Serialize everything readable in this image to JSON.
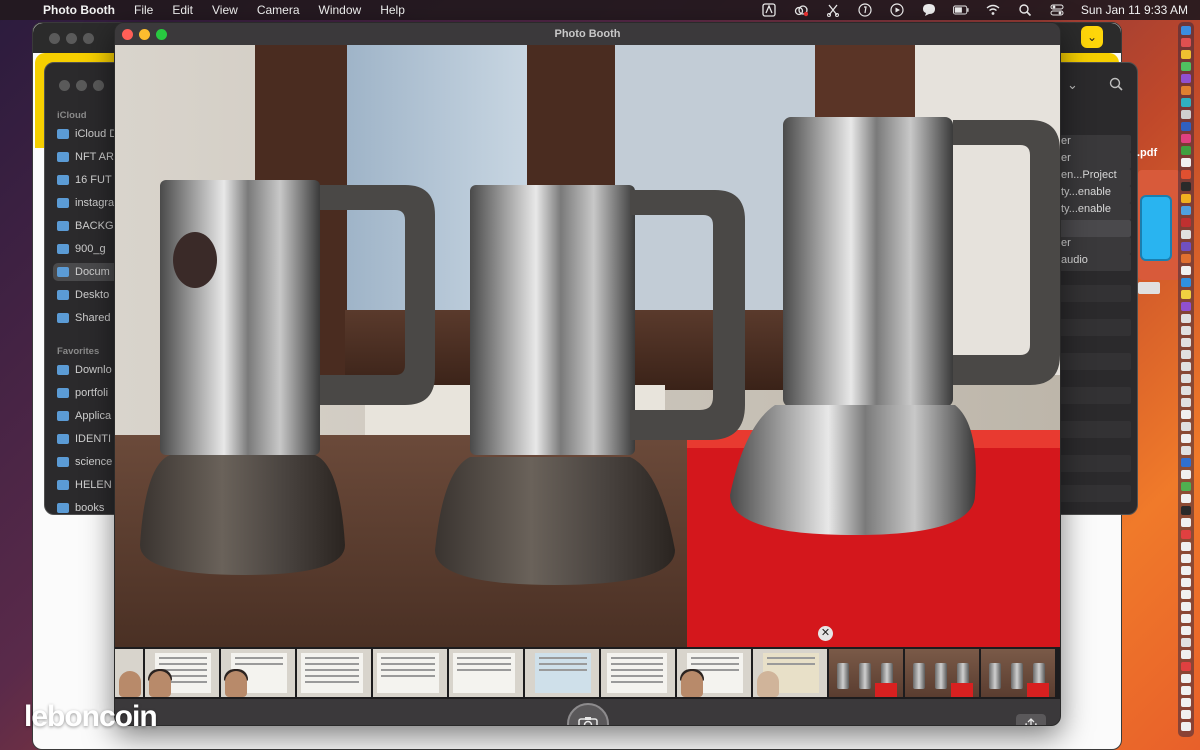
{
  "menubar": {
    "app_name": "Photo Booth",
    "menus": [
      "File",
      "Edit",
      "View",
      "Camera",
      "Window",
      "Help"
    ],
    "status_icons": [
      "adobe-icon",
      "creative-cloud-icon",
      "scissors-icon",
      "scroll-icon",
      "play-icon",
      "message-icon",
      "battery-icon",
      "wifi-icon",
      "search-icon",
      "control-center-icon"
    ],
    "datetime": "Sun Jan 11  9:33 AM"
  },
  "finder": {
    "section_icloud": "iCloud",
    "section_favorites": "Favorites",
    "icloud_items": [
      "iCloud D",
      "NFT AR",
      "16 FUT",
      "instagra",
      "BACKG",
      "900_g",
      "Docum",
      "Deskto",
      "Shared"
    ],
    "favorite_items": [
      "Downlo",
      "portfoli",
      "Applica",
      "IDENTI",
      "science",
      "HELEN",
      "books"
    ],
    "right_list": [
      "er",
      "er",
      "en...Project",
      "ty...enable",
      "ty...enable",
      "",
      "er",
      "audio"
    ]
  },
  "pdf_label": ".pdf",
  "photo_booth": {
    "title": "Photo Booth",
    "thumbnails": [
      {
        "kind": "partial"
      },
      {
        "kind": "person-doc"
      },
      {
        "kind": "person-doc"
      },
      {
        "kind": "doc"
      },
      {
        "kind": "doc"
      },
      {
        "kind": "doc"
      },
      {
        "kind": "id-card"
      },
      {
        "kind": "doc"
      },
      {
        "kind": "person-doc"
      },
      {
        "kind": "person-doc"
      },
      {
        "kind": "pots",
        "selected": true
      },
      {
        "kind": "pots"
      },
      {
        "kind": "pots"
      }
    ],
    "close_glyph": "✕"
  },
  "watermark": "leboncoin",
  "colors": {
    "traffic_red": "#ff5f57",
    "traffic_yellow": "#febc2e",
    "traffic_green": "#28c840",
    "selection_blue": "#2f7fe0",
    "yellow_toolbar": "#f6cf00"
  }
}
